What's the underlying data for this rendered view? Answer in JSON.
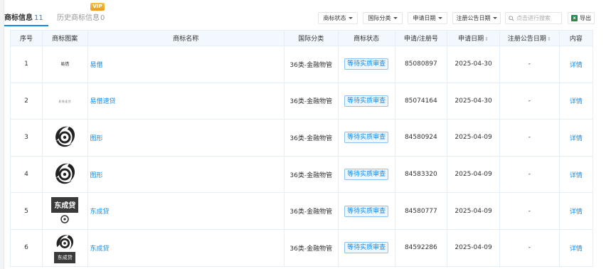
{
  "tabs": {
    "main_label": "商标信息",
    "main_count": "11",
    "history_label": "历史商标信息",
    "history_count": "0",
    "vip_badge": "VIP"
  },
  "filters": {
    "status": "商标状态",
    "intl_class": "国际分类",
    "apply_date": "申请日期",
    "reg_notice_date": "注册公告日期",
    "search_placeholder": "点击进行搜索",
    "export": "导出"
  },
  "columns": [
    "序号",
    "商标图案",
    "商标名称",
    "国际分类",
    "商标状态",
    "申请/注册号",
    "申请日期",
    "注册公告日期",
    "内容"
  ],
  "rows": [
    {
      "idx": "1",
      "logo_text": "易借",
      "name": "易借",
      "class": "36类-金融物管",
      "status": "等待实质审查",
      "reg_no": "85080897",
      "apply_date": "2025-04-30",
      "notice_date": "-",
      "action": "详情"
    },
    {
      "idx": "2",
      "logo_text": "易借速贷",
      "name": "易借速贷",
      "class": "36类-金融物管",
      "status": "等待实质审查",
      "reg_no": "85074164",
      "apply_date": "2025-04-30",
      "notice_date": "-",
      "action": "详情"
    },
    {
      "idx": "3",
      "logo_text": "",
      "name": "图形",
      "class": "36类-金融物管",
      "status": "等待实质审查",
      "reg_no": "84580924",
      "apply_date": "2025-04-09",
      "notice_date": "-",
      "action": "详情"
    },
    {
      "idx": "4",
      "logo_text": "",
      "name": "图形",
      "class": "36类-金融物管",
      "status": "等待实质审查",
      "reg_no": "84583320",
      "apply_date": "2025-04-09",
      "notice_date": "-",
      "action": "详情"
    },
    {
      "idx": "5",
      "logo_text": "东成贷",
      "name": "东成贷",
      "class": "36类-金融物管",
      "status": "等待实质审查",
      "reg_no": "84580777",
      "apply_date": "2025-04-09",
      "notice_date": "-",
      "action": "详情"
    },
    {
      "idx": "6",
      "logo_text": "东成贷",
      "name": "东成贷",
      "class": "36类-金融物管",
      "status": "等待实质审查",
      "reg_no": "84592286",
      "apply_date": "2025-04-09",
      "notice_date": "-",
      "action": "详情"
    }
  ],
  "colors": {
    "accent": "#128bed",
    "header_bg": "#f2f8fe",
    "border": "#e4eef6"
  }
}
